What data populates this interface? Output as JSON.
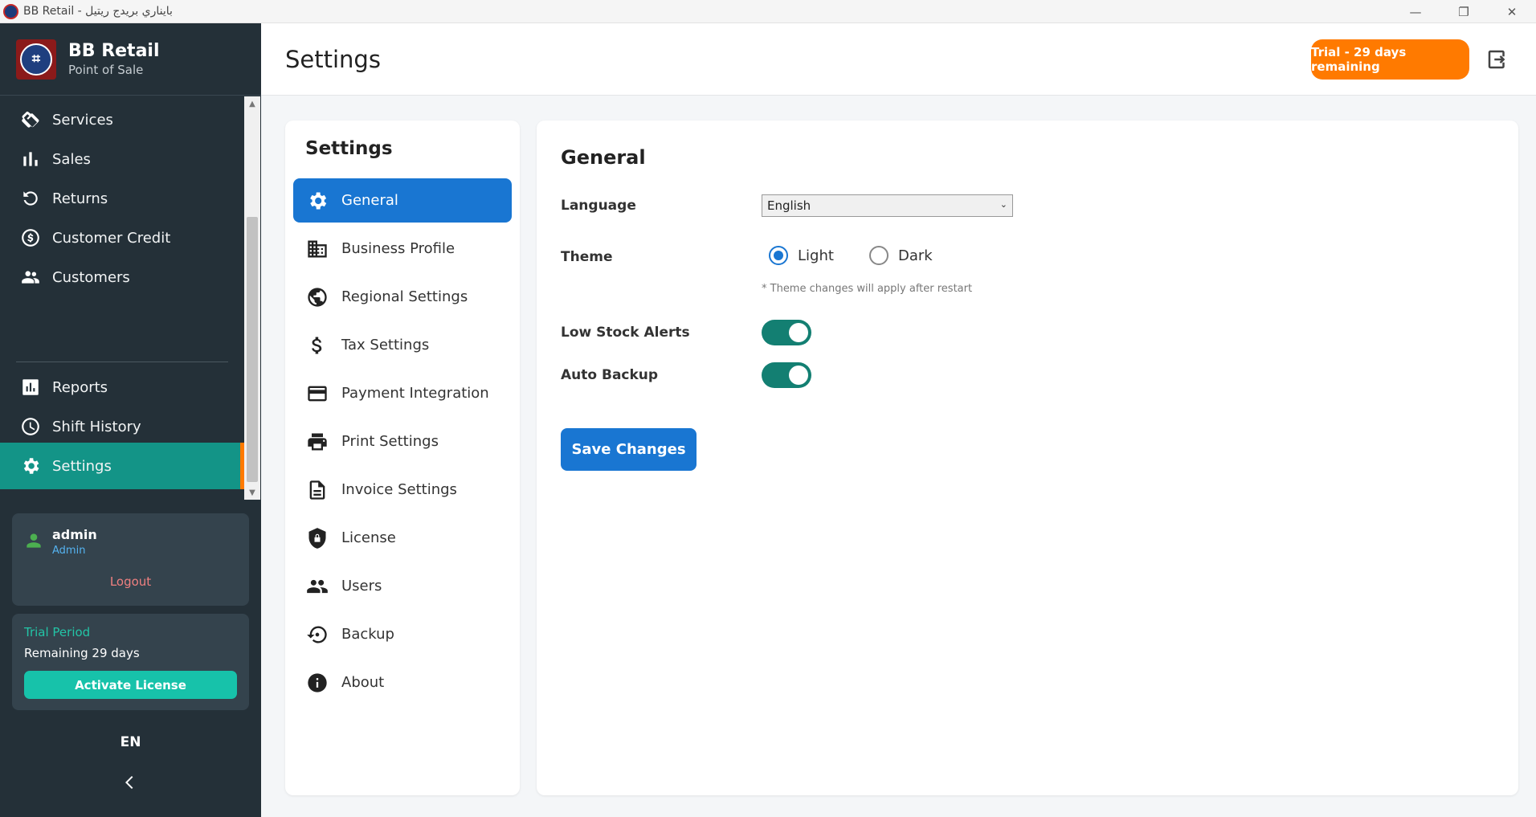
{
  "window": {
    "title": "BB Retail - بايناري بريدج ريتيل",
    "controls": [
      "minimize",
      "restore",
      "close"
    ]
  },
  "brand": {
    "name": "BB Retail",
    "subtitle": "Point of Sale"
  },
  "sidebar": {
    "items": [
      {
        "label": "Services",
        "icon": "handshake-icon"
      },
      {
        "label": "Sales",
        "icon": "bar-chart-icon"
      },
      {
        "label": "Returns",
        "icon": "undo-icon"
      },
      {
        "label": "Customer Credit",
        "icon": "dollar-circle-icon"
      },
      {
        "label": "Customers",
        "icon": "people-icon"
      },
      {
        "label": "Reports",
        "icon": "report-icon"
      },
      {
        "label": "Shift History",
        "icon": "clock-icon"
      },
      {
        "label": "Settings",
        "icon": "gear-icon",
        "active": true
      }
    ],
    "user": {
      "name": "admin",
      "role": "Admin",
      "logout_label": "Logout"
    },
    "trial": {
      "label": "Trial Period",
      "remaining": "Remaining 29 days",
      "activate_label": "Activate License"
    },
    "language_code": "EN"
  },
  "header": {
    "title": "Settings",
    "trial_badge": "Trial - 29 days remaining"
  },
  "settings_menu": {
    "title": "Settings",
    "items": [
      {
        "label": "General",
        "icon": "gear-icon",
        "active": true
      },
      {
        "label": "Business Profile",
        "icon": "building-icon"
      },
      {
        "label": "Regional Settings",
        "icon": "globe-icon"
      },
      {
        "label": "Tax Settings",
        "icon": "dollar-icon"
      },
      {
        "label": "Payment Integration",
        "icon": "credit-card-icon"
      },
      {
        "label": "Print Settings",
        "icon": "printer-icon"
      },
      {
        "label": "Invoice Settings",
        "icon": "document-icon"
      },
      {
        "label": "License",
        "icon": "shield-lock-icon"
      },
      {
        "label": "Users",
        "icon": "users-icon"
      },
      {
        "label": "Backup",
        "icon": "backup-icon"
      },
      {
        "label": "About",
        "icon": "info-icon"
      }
    ]
  },
  "general": {
    "title": "General",
    "language_label": "Language",
    "language_value": "English",
    "theme_label": "Theme",
    "theme_options": [
      "Light",
      "Dark"
    ],
    "theme_selected": "Light",
    "theme_hint": "* Theme changes will apply after restart",
    "low_stock_label": "Low Stock Alerts",
    "low_stock_enabled": true,
    "auto_backup_label": "Auto Backup",
    "auto_backup_enabled": true,
    "save_label": "Save Changes"
  },
  "colors": {
    "sidebar_bg": "#243038",
    "active_nav": "#139487",
    "accent_orange": "#ff7a00",
    "primary_blue": "#1976d2",
    "toggle_on": "#137f72"
  }
}
